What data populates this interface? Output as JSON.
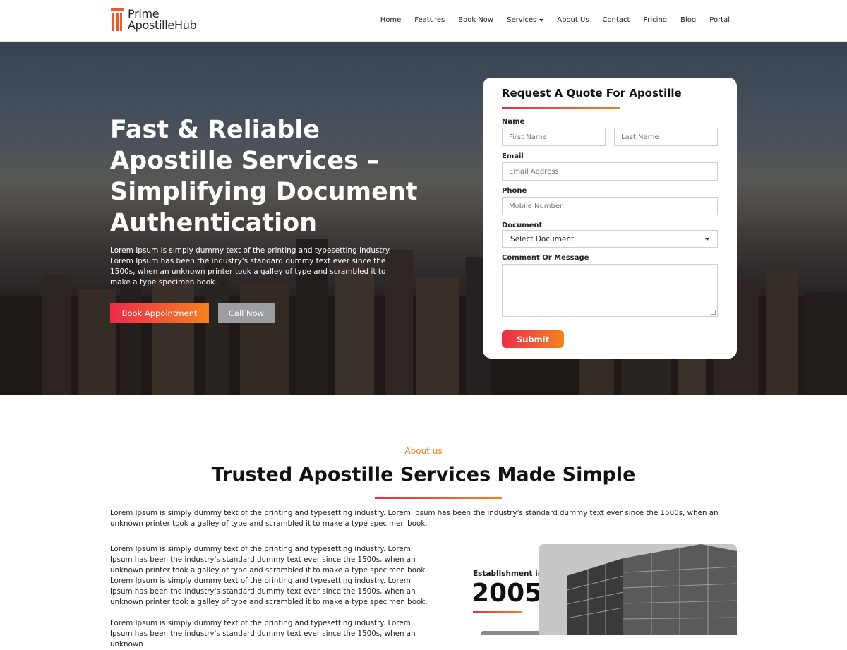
{
  "brand": {
    "line1": "Prime",
    "line2": "ApostilleHub",
    "accent": "#f15a24"
  },
  "nav": {
    "items": [
      "Home",
      "Features",
      "Book Now",
      "Services",
      "About Us",
      "Contact",
      "Pricing",
      "Blog",
      "Portal"
    ],
    "dropdown_item": "Services"
  },
  "hero": {
    "title": "Fast & Reliable Apostille Services – Simplifying Document Authentication",
    "text": "Lorem Ipsum is simply dummy text of the printing and typesetting industry. Lorem Ipsum has been the industry's standard dummy text ever since the 1500s, when an unknown printer took a galley of type and scrambled it to make a type specimen book.",
    "book_label": "Book Appointment",
    "call_label": "Call Now"
  },
  "form": {
    "title": "Request A Quote For Apostille",
    "name_label": "Name",
    "first_placeholder": "First Name",
    "last_placeholder": "Last Name",
    "email_label": "Email",
    "email_placeholder": "Email Address",
    "phone_label": "Phone",
    "phone_placeholder": "Mobile Number",
    "document_label": "Document",
    "document_selected": "Select Document",
    "comment_label": "Comment Or Message",
    "submit_label": "Submit"
  },
  "about": {
    "kicker": "About us",
    "title": "Trusted Apostille Services Made Simple",
    "intro": "Lorem Ipsum is simply dummy text of the printing and typesetting industry. Lorem Ipsum has been the industry's standard dummy text ever since the 1500s, when an unknown printer took a galley of type and scrambled it to make a type specimen book.",
    "p1": "Lorem Ipsum is simply dummy text of the printing and typesetting industry. Lorem Ipsum has been the industry's standard dummy text ever since the 1500s, when an unknown printer took a galley of type and scrambled it to make a type specimen book.  Lorem Ipsum is simply dummy text of the printing and typesetting industry. Lorem Ipsum has been the industry's standard dummy text ever since the 1500s, when an unknown printer took a galley of type and scrambled it to make a type specimen book.",
    "p2": "Lorem Ipsum is simply dummy text of the printing and typesetting industry. Lorem Ipsum has been the industry's standard dummy text ever since the 1500s, when an unknown",
    "est_label": "Establishment in",
    "est_year": "2005"
  },
  "colors": {
    "gradient_start": "#ee2a4b",
    "gradient_end": "#f5821f",
    "kicker": "#f07f1e"
  }
}
